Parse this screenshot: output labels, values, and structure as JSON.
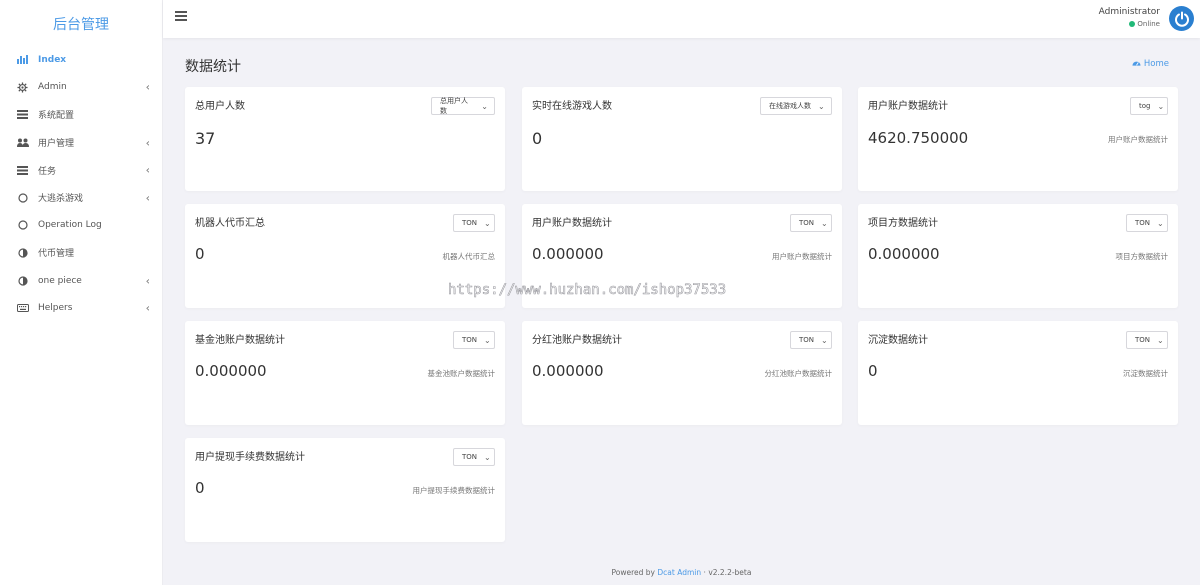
{
  "brand": "后台管理",
  "sidebar": {
    "items": [
      {
        "label": "Index",
        "icon": "bar-chart-icon",
        "active": true,
        "chevron": false
      },
      {
        "label": "Admin",
        "icon": "gear-icon",
        "chevron": true
      },
      {
        "label": "系统配置",
        "icon": "list-icon",
        "chevron": false
      },
      {
        "label": "用户管理",
        "icon": "users-icon",
        "chevron": true
      },
      {
        "label": "任务",
        "icon": "list-icon",
        "chevron": true
      },
      {
        "label": "大逃杀游戏",
        "icon": "circle-icon",
        "chevron": true
      },
      {
        "label": "Operation Log",
        "icon": "circle-icon",
        "chevron": false
      },
      {
        "label": "代币管理",
        "icon": "half-circle-icon",
        "chevron": false
      },
      {
        "label": "one piece",
        "icon": "half-circle-icon",
        "chevron": true
      },
      {
        "label": "Helpers",
        "icon": "keyboard-icon",
        "chevron": true
      }
    ]
  },
  "topbar": {
    "user_name": "Administrator",
    "status": "Online"
  },
  "page": {
    "title": "数据统计",
    "breadcrumb": "Home"
  },
  "cards": [
    {
      "title": "总用户人数",
      "select": "总用户人数",
      "value": "37",
      "sub": ""
    },
    {
      "title": "实时在线游戏人数",
      "select": "在线游戏人数",
      "value": "0",
      "sub": ""
    },
    {
      "title": "用户账户数据统计",
      "select": "tog",
      "value": "4620.750000",
      "sub": "用户账户数据统计"
    },
    {
      "title": "机器人代币汇总",
      "select": "TON",
      "value": "0",
      "sub": "机器人代币汇总"
    },
    {
      "title": "用户账户数据统计",
      "select": "TON",
      "value": "0.000000",
      "sub": "用户账户数据统计"
    },
    {
      "title": "项目方数据统计",
      "select": "TON",
      "value": "0.000000",
      "sub": "项目方数据统计"
    },
    {
      "title": "基金池账户数据统计",
      "select": "TON",
      "value": "0.000000",
      "sub": "基金池账户数据统计"
    },
    {
      "title": "分红池账户数据统计",
      "select": "TON",
      "value": "0.000000",
      "sub": "分红池账户数据统计"
    },
    {
      "title": "沉淀数据统计",
      "select": "TON",
      "value": "0",
      "sub": "沉淀数据统计"
    },
    {
      "title": "用户提现手续费数据统计",
      "select": "TON",
      "value": "0",
      "sub": "用户提现手续费数据统计"
    }
  ],
  "watermark": "https://www.huzhan.com/ishop37533",
  "footer": {
    "prefix": "Powered by",
    "link": "Dcat Admin",
    "sep": "·",
    "version": "v2.2.2-beta"
  },
  "colors": {
    "accent": "#4c9ae6",
    "online": "#21b978",
    "avatar": "#2a7fd0",
    "background": "#f2f2f7"
  }
}
